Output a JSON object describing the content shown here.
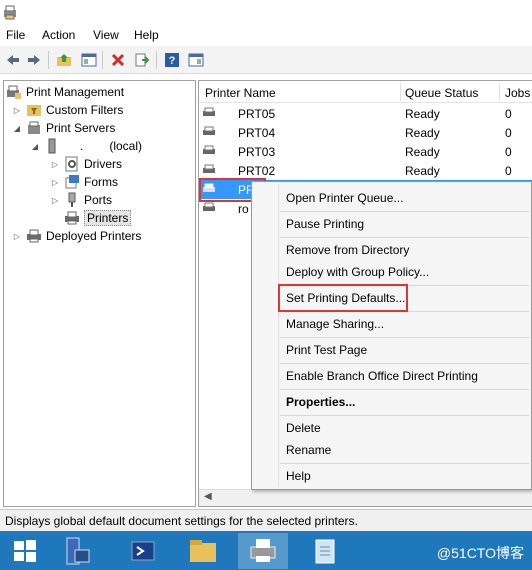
{
  "menu": {
    "file": "File",
    "action": "Action",
    "view": "View",
    "help": "Help"
  },
  "toolbar": {
    "icons": [
      "back-arrow-icon",
      "forward-arrow-icon",
      "up-folder-icon",
      "show-hide-tree-icon",
      "delete-icon",
      "export-list-icon",
      "help-icon",
      "properties-icon"
    ]
  },
  "tree": {
    "root": "Print Management",
    "custom_filters": "Custom Filters",
    "print_servers": "Print Servers",
    "server_dots": ".",
    "server_local": "(local)",
    "drivers": "Drivers",
    "forms": "Forms",
    "ports": "Ports",
    "printers": "Printers",
    "deployed_printers": "Deployed Printers"
  },
  "list": {
    "columns": {
      "name": "Printer Name",
      "status": "Queue Status",
      "jobs": "Jobs"
    },
    "rows": [
      {
        "name": "PRT05",
        "status": "Ready",
        "jobs": "0"
      },
      {
        "name": "PRT04",
        "status": "Ready",
        "jobs": "0"
      },
      {
        "name": "PRT03",
        "status": "Ready",
        "jobs": "0"
      },
      {
        "name": "PRT02",
        "status": "Ready",
        "jobs": "0"
      }
    ],
    "selected_row_name": "PR",
    "next_row_fragment": "ro"
  },
  "context_menu": {
    "open_queue": "Open Printer Queue...",
    "pause": "Pause Printing",
    "remove_directory": "Remove from Directory",
    "deploy_gp": "Deploy with Group Policy...",
    "set_defaults": "Set Printing Defaults...",
    "manage_sharing": "Manage Sharing...",
    "print_test": "Print Test Page",
    "branch_office": "Enable Branch Office Direct Printing",
    "properties": "Properties...",
    "delete": "Delete",
    "rename": "Rename",
    "help": "Help"
  },
  "status_bar": {
    "text": "Displays global default document settings for the selected printers."
  },
  "taskbar": {
    "watermark": "@51CTO博客",
    "buttons": [
      "start-icon",
      "server-manager-icon",
      "powershell-icon",
      "file-explorer-icon",
      "print-management-icon",
      "notepad-icon"
    ]
  },
  "colors": {
    "highlight": "#e03333",
    "selection": "#3399ff",
    "taskbar": "#1e78bb"
  }
}
